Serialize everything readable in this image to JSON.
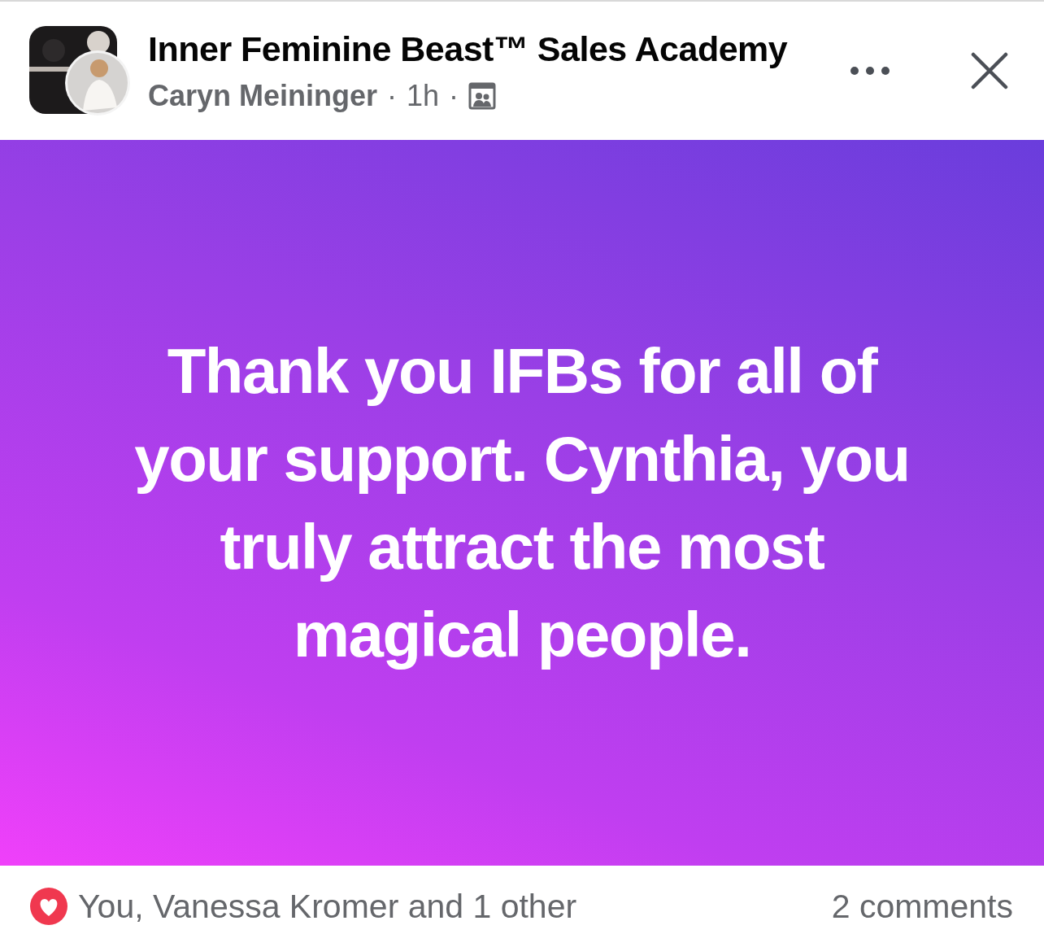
{
  "post": {
    "group": "Inner Feminine Beast™ Sales Academy",
    "author": "Caryn Meininger",
    "separator_1": "·",
    "time": "1h",
    "separator_2": "·",
    "message": "Thank you IFBs for all of your support. Cynthia, you truly attract the most magical people."
  },
  "reactions": {
    "summary": "You, Vanessa Kromer and 1 other",
    "comments": "2 comments"
  }
}
